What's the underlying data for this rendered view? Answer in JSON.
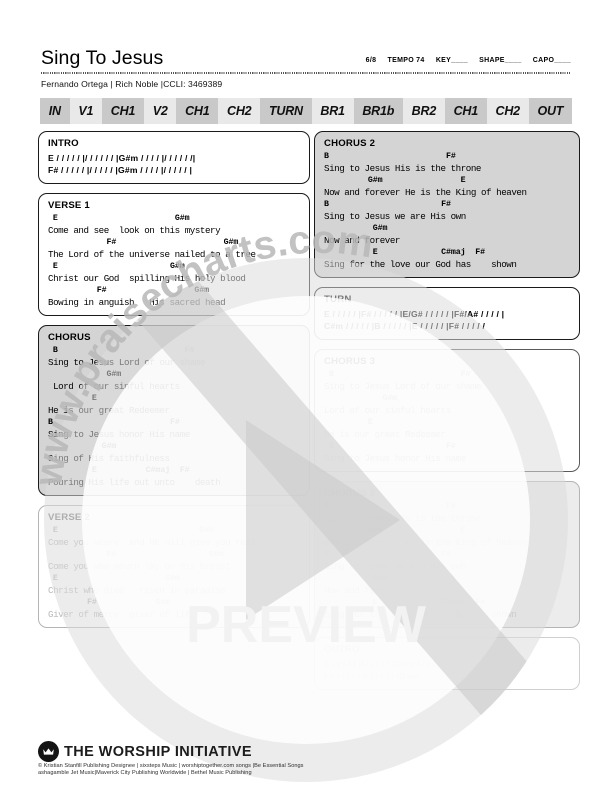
{
  "header": {
    "title": "Sing To Jesus",
    "credits": "Fernando Ortega | Rich Noble |CCLI: 3469389",
    "meta": {
      "time_signature": "6/8",
      "tempo": "TEMPO 74",
      "key": "KEY____",
      "shape": "SHAPE____",
      "capo": "CAPO____"
    }
  },
  "navbar": [
    {
      "label": "IN",
      "shade": "dark"
    },
    {
      "label": "V1",
      "shade": "light"
    },
    {
      "label": "CH1",
      "shade": "dark"
    },
    {
      "label": "V2",
      "shade": "light"
    },
    {
      "label": "CH1",
      "shade": "dark"
    },
    {
      "label": "CH2",
      "shade": "light"
    },
    {
      "label": "TURN",
      "shade": "dark"
    },
    {
      "label": "BR1",
      "shade": "light"
    },
    {
      "label": "BR1b",
      "shade": "dark"
    },
    {
      "label": "BR2",
      "shade": "light"
    },
    {
      "label": "CH1",
      "shade": "dark"
    },
    {
      "label": "CH2",
      "shade": "light"
    },
    {
      "label": "OUT",
      "shade": "dark"
    }
  ],
  "left_column": {
    "intro": {
      "title": "INTRO",
      "lines": [
        "E / / / / / |/ / / / / / |G#m / / / / |/ / / / / /|",
        "F# / / / / / |/ / / / / |G#m / / / / |/ / / / / |"
      ]
    },
    "verse1": {
      "title": "VERSE 1",
      "pairs": [
        {
          "chords": " E                        G#m",
          "lyric": "Come and see  look on this mystery"
        },
        {
          "chords": "            F#                      G#m",
          "lyric": "The Lord of the universe nailed to a tree"
        },
        {
          "chords": " E                       G#m",
          "lyric": "Christ our God  spilling His holy blood"
        },
        {
          "chords": "          F#                  G#m",
          "lyric": "Bowing in anguish   His sacred head"
        }
      ]
    },
    "chorus": {
      "title": "CHORUS",
      "pairs": [
        {
          "chords": " B                          F#",
          "lyric": "Sing to Jesus Lord of our shame"
        },
        {
          "chords": "            G#m",
          "lyric": " Lord of our sinful hearts"
        },
        {
          "chords": "         E",
          "lyric": "He is our great Redeemer"
        },
        {
          "chords": "B                        F#",
          "lyric": "Sing to Jesus honor His name"
        },
        {
          "chords": "           G#m",
          "lyric": "Sing of His faithfulness"
        },
        {
          "chords": "         E          C#maj  F#",
          "lyric": "Pouring His life out unto    death"
        }
      ]
    },
    "verse2": {
      "title": "VERSE 2",
      "pairs": [
        {
          "chords": " E                             G#m",
          "lyric": "Come you weary  and He will give you rest"
        },
        {
          "chords": "            F#                   G#m",
          "lyric": "Come you who mourn lay on His breast"
        },
        {
          "chords": " E                      G#m",
          "lyric": "Christ who died   risen in paradise"
        },
        {
          "chords": "        F#            G#m",
          "lyric": "Giver of mercy  giver of life"
        }
      ]
    }
  },
  "right_column": {
    "chorus2a": {
      "title": "CHORUS 2",
      "pairs": [
        {
          "chords": "B                        F#",
          "lyric": "Sing to Jesus His is the throne"
        },
        {
          "chords": "         G#m                E",
          "lyric": "Now and forever He is the King of heaven"
        },
        {
          "chords": "B                       F#",
          "lyric": "Sing to Jesus we are His own"
        },
        {
          "chords": "          G#m",
          "lyric": "Now and forever"
        },
        {
          "chords": "          E             C#maj  F#",
          "lyric": "Sing for the love our God has    shown"
        }
      ]
    },
    "turn": {
      "title": "TURN",
      "lines": [
        "E / / / / / |F# / / / / / |E/G# / / / / / |F#/A# / / / / |",
        "C#m / / / / / |B / / / / / |E / / / / / |F# / / / / /"
      ]
    },
    "chorus3": {
      "title": "CHORUS 3",
      "pairs": [
        {
          "chords": " B                          F#",
          "lyric": "Sing to Jesus Lord of our shame"
        },
        {
          "chords": "            G#m",
          "lyric": "Lord of our sinful hearts"
        },
        {
          "chords": "         E",
          "lyric": "He is our great Redeemer"
        },
        {
          "chords": " B                       F#",
          "lyric": "Sing to Jesus honor His name"
        }
      ]
    },
    "chorus2b": {
      "title": "CHORUS 2",
      "pairs": [
        {
          "chords": "B                        F#",
          "lyric": "Sing to Jesus His is the throne"
        },
        {
          "chords": "         G#m                E",
          "lyric": "Now and forever He is the King of heaven"
        },
        {
          "chords": "B                       F#",
          "lyric": "Sing to Jesus we are His own"
        },
        {
          "chords": "          G#m",
          "lyric": "Now and forever"
        },
        {
          "chords": "          E             C#maj  F#",
          "lyric": "Sing for the love our God has    shown"
        }
      ]
    },
    "outro": {
      "title": "OUTRO",
      "lines": [
        "E / / / / / |/ / / / / / |G#m / / / / |/ / / / / /|",
        "F# / / / / / |/ / / / / / |G#m"
      ]
    }
  },
  "watermark": {
    "arc_text": "www.praisecharts.com",
    "preview_text": "PREVIEW"
  },
  "footer": {
    "logo_text": "THE WORSHIP INITIATIVE",
    "copyright_line1": "© Kristian Stanfill Publishing Designee | sixsteps Music | worshiptogether.com songs |Be Essential Songs",
    "copyright_line2": "ashagamble Jet Music|Maverick City Publishing Worldwide | Bethel Music Publishing"
  }
}
